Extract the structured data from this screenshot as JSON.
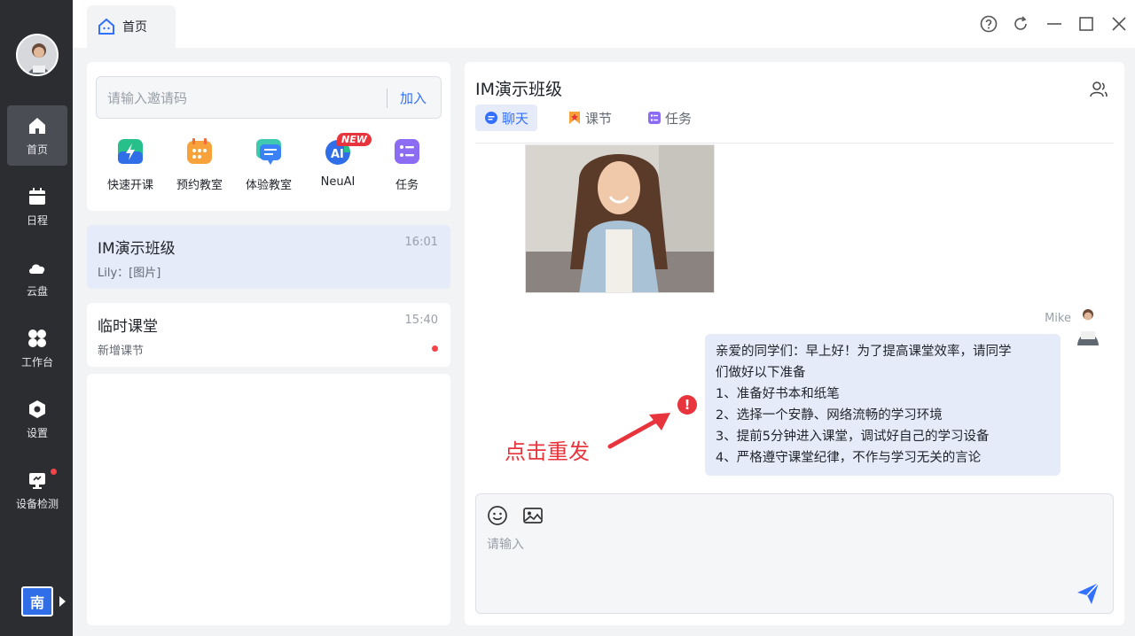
{
  "nav": {
    "items": [
      {
        "label": "首页"
      },
      {
        "label": "日程"
      },
      {
        "label": "云盘"
      },
      {
        "label": "工作台"
      },
      {
        "label": "设置"
      },
      {
        "label": "设备检测"
      }
    ],
    "lang": "南"
  },
  "topbar": {
    "home_tab": "首页"
  },
  "invite": {
    "placeholder": "请输入邀请码",
    "join": "加入"
  },
  "quick": [
    {
      "label": "快速开课"
    },
    {
      "label": "预约教室"
    },
    {
      "label": "体验教室"
    },
    {
      "label": "NeuAI",
      "badge": "NEW"
    },
    {
      "label": "任务"
    }
  ],
  "conversations": [
    {
      "name": "IM演示班级",
      "time": "16:01",
      "last": "Lily：[图片]"
    },
    {
      "name": "临时课堂",
      "time": "15:40",
      "last": "新增课节"
    }
  ],
  "chat": {
    "title": "IM演示班级",
    "tabs": [
      {
        "label": "聊天"
      },
      {
        "label": "课节"
      },
      {
        "label": "任务"
      }
    ],
    "sender": "Mike",
    "message_lines": [
      "亲爱的同学们：早上好！为了提高课堂效率，请同学",
      "们做好以下准备",
      "1、准备好书本和纸笔",
      "2、选择一个安静、网络流畅的学习环境",
      "3、提前5分钟进入课堂，调试好自己的学习设备",
      "4、严格遵守课堂纪律，不作与学习无关的言论"
    ],
    "error_mark": "!",
    "annotation": "点击重发",
    "input_placeholder": "请输入"
  },
  "colors": {
    "accent": "#3370ff",
    "rail": "#2b2d31",
    "alert": "#e8343c"
  }
}
